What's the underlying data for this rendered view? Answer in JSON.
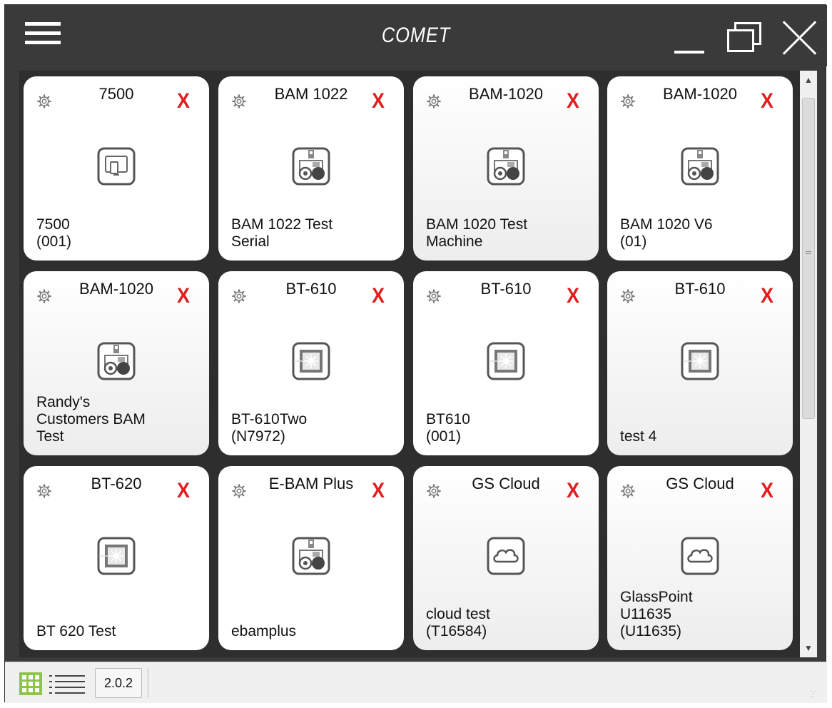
{
  "window": {
    "title": "COMET"
  },
  "tiles": [
    {
      "title": "7500",
      "close": "X",
      "icon": "tablet-device-icon",
      "lines": [
        "7500",
        "(001)"
      ]
    },
    {
      "title": "BAM 1022",
      "close": "X",
      "icon": "bam-monitor-icon",
      "lines": [
        "BAM 1022 Test",
        "Serial"
      ]
    },
    {
      "title": "BAM-1020",
      "close": "X",
      "icon": "bam-monitor-icon",
      "lines": [
        "BAM 1020 Test",
        "Machine"
      ]
    },
    {
      "title": "BAM-1020",
      "close": "X",
      "icon": "bam-monitor-icon",
      "lines": [
        "BAM 1020 V6",
        "(01)"
      ]
    },
    {
      "title": "BAM-1020",
      "close": "X",
      "icon": "bam-monitor-icon",
      "lines": [
        "Randy's",
        "Customers BAM",
        "Test"
      ]
    },
    {
      "title": "BT-610",
      "close": "X",
      "icon": "laser-particle-icon",
      "lines": [
        "BT-610Two",
        "(N7972)"
      ]
    },
    {
      "title": "BT-610",
      "close": "X",
      "icon": "laser-particle-icon",
      "lines": [
        "BT610",
        "(001)"
      ]
    },
    {
      "title": "BT-610",
      "close": "X",
      "icon": "laser-particle-icon",
      "lines": [
        "test 4"
      ]
    },
    {
      "title": "BT-620",
      "close": "X",
      "icon": "laser-particle-icon",
      "lines": [
        "BT 620 Test"
      ]
    },
    {
      "title": "E-BAM Plus",
      "close": "X",
      "icon": "bam-monitor-icon",
      "lines": [
        "ebamplus"
      ]
    },
    {
      "title": "GS Cloud",
      "close": "X",
      "icon": "cloud-icon",
      "lines": [
        "cloud test",
        "(T16584)"
      ]
    },
    {
      "title": "GS Cloud",
      "close": "X",
      "icon": "cloud-icon",
      "lines": [
        "GlassPoint",
        "U11635",
        "(U11635)"
      ]
    }
  ],
  "statusbar": {
    "version": "2.0.2"
  },
  "colors": {
    "frame": "#3a3a3a",
    "close_x": "#e01e1e",
    "grid_view_active": "#8dc63f"
  }
}
